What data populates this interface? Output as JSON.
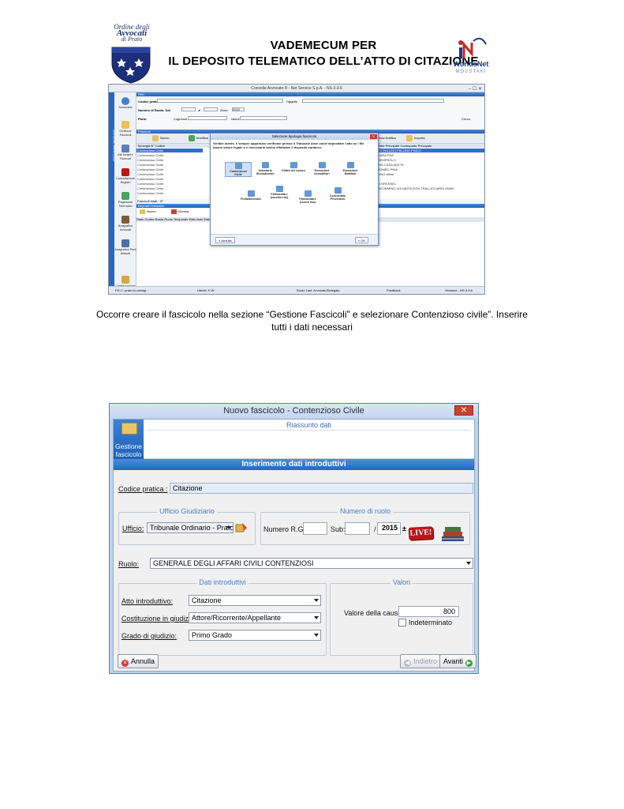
{
  "header": {
    "logo_left": {
      "line1": "Ordine degli",
      "line2": "Avvocati",
      "line3": "di Prato"
    },
    "title_line1": "VADEMECUM PER",
    "title_line2": "IL DEPOSITO TELEMATICO DELL’ATTO DI CITAZIONE",
    "logo_right": {
      "name": "WorldsNet",
      "sub": "MOUSTAKI"
    }
  },
  "screenshot1": {
    "window_title": "Consolle Avvocato ® - Net Service S.p.A. - NS-3.9.6",
    "window_buttons": "–  ☐  ✕",
    "side_label": "Consolle Avvocato",
    "nav": [
      "Sommario",
      "Gestione Fascicoli",
      "Atti Inviati e Ricevuti",
      "Consultazione Registri",
      "Pagamenti Telematici",
      "Anagrafica Avvocati",
      "Anagrafica Parti Abituali",
      "Configurazione"
    ],
    "filter_bar": "Filtri",
    "filter_rows": [
      "Codice pratica:",
      "Numero di Ruolo: Dal",
      "Parte:"
    ],
    "filter_misc": {
      "oggetto": "Oggetto",
      "al": "al",
      "anno": "Anno:",
      "anno_val": "2015",
      "cognome": "Cognome",
      "nome": "Nome",
      "cerca": "Cerca"
    },
    "fascicoli_bar": "Fascicoli",
    "toolbar": [
      "Nuovo",
      "Modifica",
      "Rimuovi",
      "Stampa",
      "Sincronizza",
      "Fascicolo",
      "Invia Notifica",
      "Importa"
    ],
    "grid_header_left": "Tipologia               N° Codice",
    "grid_header_right": "Parte Principale          Controparte Principale",
    "grid_left": [
      "Contenzioso Civile",
      "Contenzioso Civile",
      "Contenzioso Civile",
      "Contenzioso Civile",
      "Contenzioso Civile",
      "Contenzioso Civile",
      "Contenzioso Civile",
      "Contenzioso Civile",
      "Contenzioso Civile",
      "Contenzioso Civile"
    ],
    "grid_right": [
      "TO PALLINO         PALLINO PINCO",
      "SARA               FRA",
      "                   SEMPROLO",
      "BIO                CASA MATTA",
      "TOMBO              PINA",
      "LINO               Mihai",
      "",
      "O SPA              ENEL",
      "SCOMMINO VIA NAPOLEON  TRALLICCIARDI ANNA"
    ],
    "grid_count": "Fascicoli totali : 37",
    "depositi_bar": "Depositi Telematici",
    "depositi_toolbar": [
      "Nuovo",
      "Elimina"
    ],
    "depositi_header": "Stato     Codice Busta                                                          Ruolo Temporale   Esito Auto   Esito Cancell.   Allegati",
    "status": {
      "pec": "P.E.C: prato.ta.consigl...",
      "utente": "Utente: E.W.",
      "ruolo": "Ruolo Last: Avvocato/Delegato",
      "feedback": "Feedback",
      "versione": "Versione - NS-3.9.6"
    },
    "dialog": {
      "title": "Selezione tipologia fascicolo",
      "message": "Gentile utente, è sempre opportuno verificare presso il Tribunale dove vuole depositare l'atto se i file hanno valore legale o è necessario anche effettuare il deposito cartaceo.",
      "options": [
        "Contenzioso Civile",
        "Volontaria Giurisdizione",
        "Diritto del Lavoro",
        "Esecuzioni Immobiliari",
        "Esecuzioni Mobiliari",
        "Prefallimentare",
        "Fallimentare (vecchio rito)",
        "Fallimentare (nuovo rito)",
        "Concordato Preventivo"
      ],
      "cancel": "Annulla",
      "ok": "OK"
    }
  },
  "caption": {
    "line1": "Occorre creare il fascicolo nella sezione “Gestione Fascicoli” e selezionare Contenzioso civile”. Inserire",
    "line2": "tutti i dati necessari"
  },
  "form": {
    "title": "Nuovo fascicolo - Contenzioso Civile",
    "close": "✕",
    "side_label_1": "Gestione",
    "side_label_2": "fascicolo",
    "riassunto": "Riassunto dati",
    "section": "Inserimento dati introduttivi",
    "codice_label": "Codice pratica :",
    "codice_value": "Citazione",
    "ufficio_group": "Ufficio Giudiziario",
    "ufficio_label": "Ufficio:",
    "ufficio_value": "Tribunale Ordinario - Prato",
    "ruolo_group": "Numero di ruolo",
    "rg_label": "Numero R.G.:",
    "rg_value": "",
    "sub_label": "Sub:",
    "sub_value": "",
    "slash": "/",
    "anno_value": "2015",
    "plus_minus": "±",
    "live_badge": "LIVE!",
    "ruolo_label": "Ruolo:",
    "ruolo_value": "GENERALE DEGLI AFFARI CIVILI CONTENZIOSI",
    "dati_group": "Dati introduttivi",
    "atto_label": "Atto introduttivo:",
    "atto_value": "Citazione",
    "costituzione_label": "Costituzione in giudizio:",
    "costituzione_value": "Attore/Ricorrente/Appellante",
    "grado_label": "Grado di giudizio:",
    "grado_value": "Primo Grado",
    "valori_group": "Valori",
    "valore_label": "Valore della causa:",
    "valore_value": "800",
    "indeterminato_label": "Indeterminato",
    "indeterminato_checked": false,
    "annulla": "Annulla",
    "indietro": "Indietro",
    "avanti": "Avanti"
  }
}
